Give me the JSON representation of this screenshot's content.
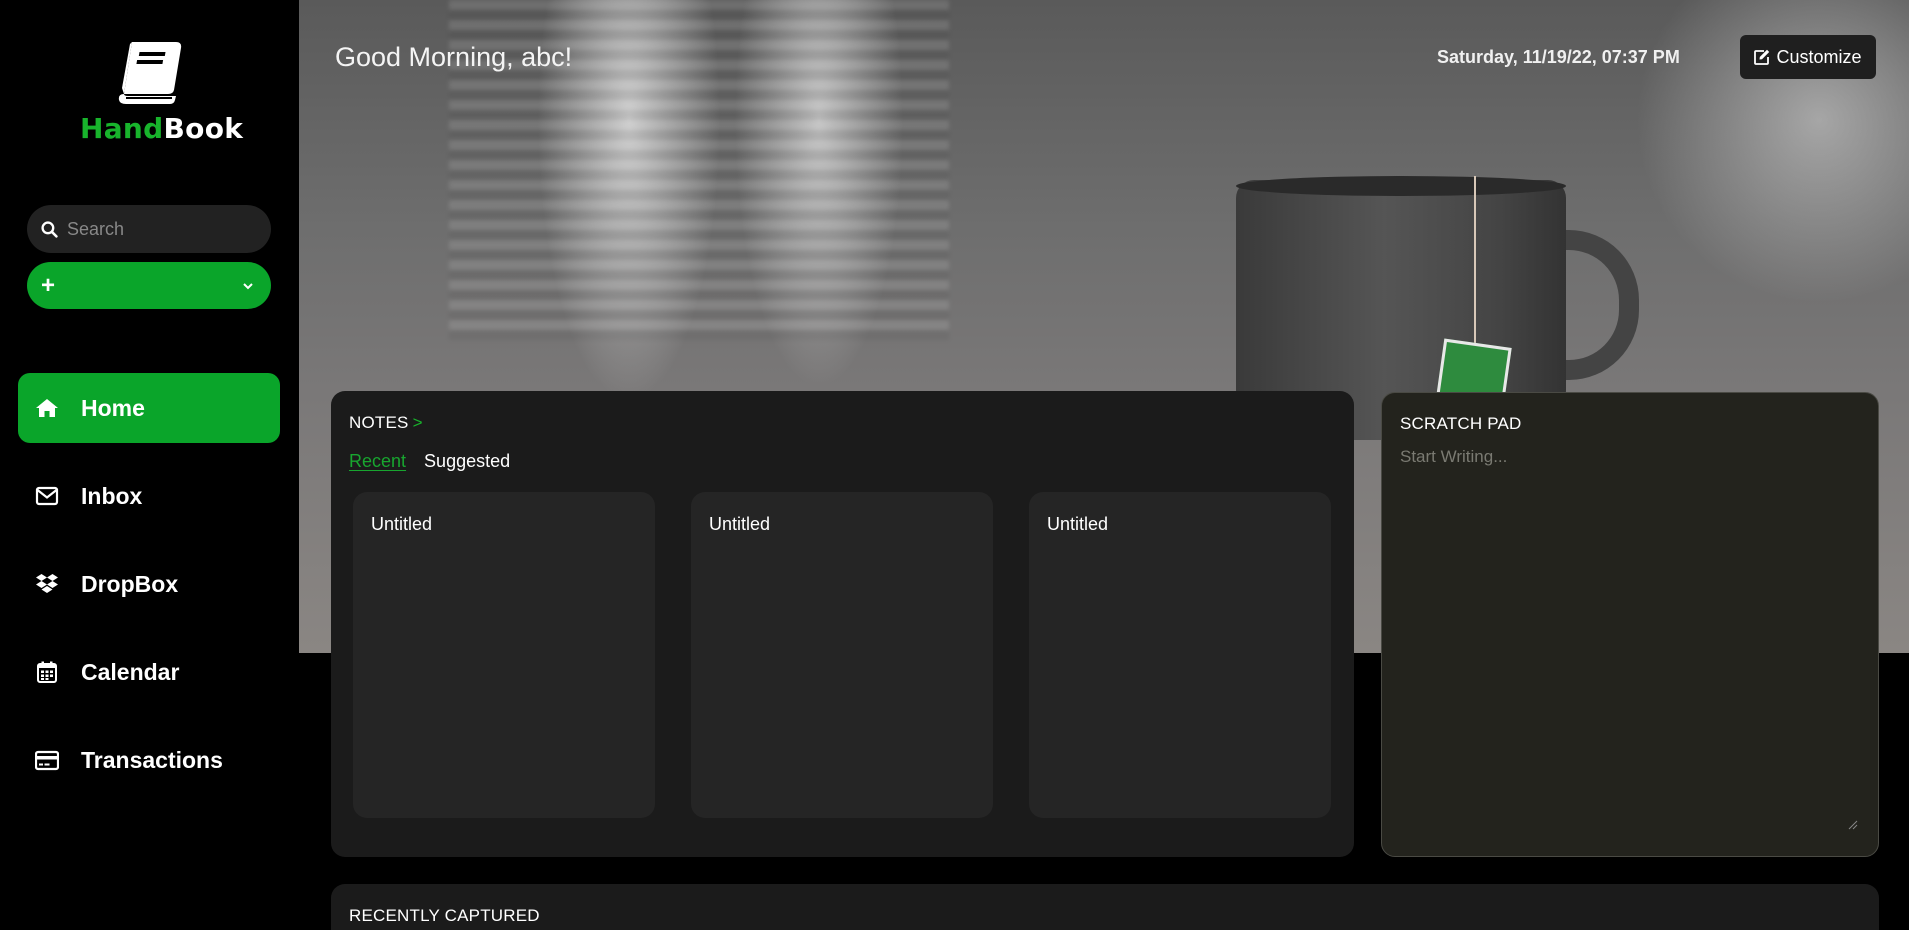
{
  "app": {
    "logo_part1": "Hand",
    "logo_part2": "Book"
  },
  "sidebar": {
    "search_placeholder": "Search",
    "new_button_icon": "plus-icon",
    "nav": [
      {
        "label": "Home",
        "icon": "home-icon",
        "active": true
      },
      {
        "label": "Inbox",
        "icon": "envelope-icon",
        "active": false
      },
      {
        "label": "DropBox",
        "icon": "dropbox-icon",
        "active": false
      },
      {
        "label": "Calendar",
        "icon": "calendar-icon",
        "active": false
      },
      {
        "label": "Transactions",
        "icon": "credit-card-icon",
        "active": false
      }
    ]
  },
  "header": {
    "greeting": "Good Morning, abc!",
    "datetime": "Saturday, 11/19/22, 07:37 PM",
    "customize_label": "Customize"
  },
  "notes": {
    "title": "NOTES",
    "chevron": ">",
    "tabs": [
      "Recent",
      "Suggested"
    ],
    "cards": [
      "Untitled",
      "Untitled",
      "Untitled"
    ]
  },
  "scratch": {
    "title": "SCRATCH PAD",
    "placeholder": "Start Writing..."
  },
  "recent": {
    "title": "RECENTLY CAPTURED"
  },
  "colors": {
    "accent": "#0aa52a",
    "accent_text": "#18b42c",
    "panel": "#1b1b1b",
    "scratch_panel": "#23231d"
  }
}
